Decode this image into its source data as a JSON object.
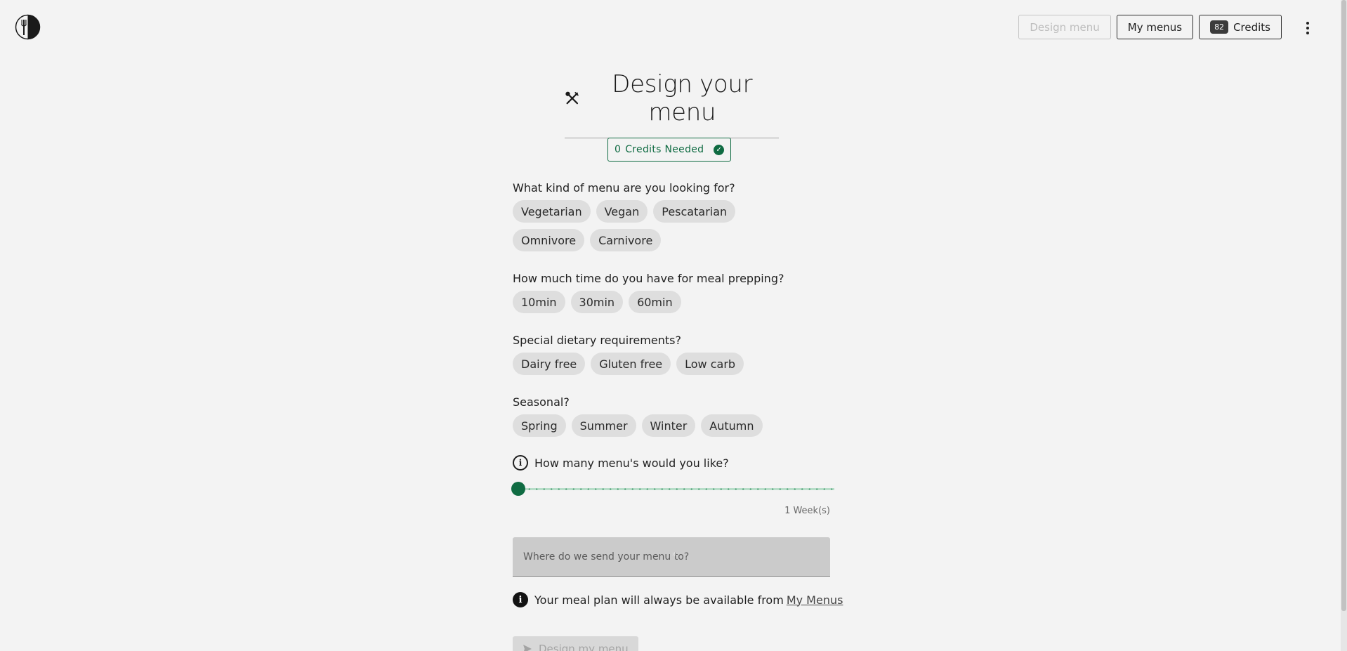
{
  "header": {
    "logo_icon": "fork-plate-icon",
    "design_menu_label": "Design menu",
    "my_menus_label": "My menus",
    "credits_count": "82",
    "credits_label": "Credits",
    "more_icon": "kebab-menu-icon"
  },
  "main": {
    "title_icon": "crossed-utensils-icon",
    "title": "Design your menu",
    "credits_needed_count": "0",
    "credits_needed_label": "Credits Needed",
    "credits_needed_icon": "check-circle-icon",
    "questions": {
      "menu_type": {
        "label": "What kind of menu are you looking for?",
        "options": [
          "Vegetarian",
          "Vegan",
          "Pescatarian",
          "Omnivore",
          "Carnivore"
        ]
      },
      "prep_time": {
        "label": "How much time do you have for meal prepping?",
        "options": [
          "10min",
          "30min",
          "60min"
        ]
      },
      "dietary": {
        "label": "Special dietary requirements?",
        "options": [
          "Dairy free",
          "Gluten free",
          "Low carb"
        ]
      },
      "seasonal": {
        "label": "Seasonal?",
        "options": [
          "Spring",
          "Summer",
          "Winter",
          "Autumn"
        ]
      }
    },
    "menus_count": {
      "label": "How many menu's would you like?",
      "slider_fraction": 0,
      "caption": "1 Week(s)"
    },
    "email": {
      "placeholder": "Where do we send your menu to?",
      "required_mark": "*"
    },
    "note": {
      "text": "Your meal plan will always be available from",
      "link": "My Menus"
    },
    "submit_label": "Design my menu",
    "submit_icon": "send-icon"
  },
  "colors": {
    "accent": "#0f6b42",
    "background": "#f3f3f3",
    "chip": "#dedede"
  }
}
